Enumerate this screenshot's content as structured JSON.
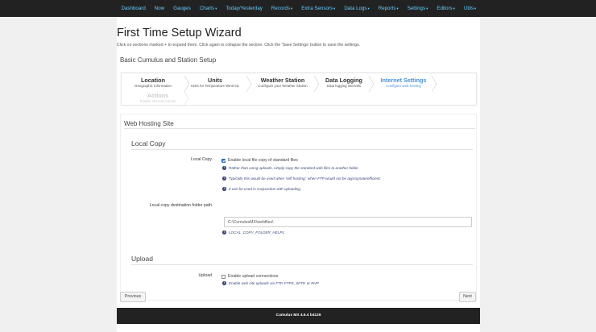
{
  "nav": {
    "items": [
      {
        "label": "Dashboard",
        "dropdown": false
      },
      {
        "label": "Now",
        "dropdown": false
      },
      {
        "label": "Gauges",
        "dropdown": false
      },
      {
        "label": "Charts",
        "dropdown": true
      },
      {
        "label": "Today/Yesterday",
        "dropdown": false
      },
      {
        "label": "Records",
        "dropdown": true
      },
      {
        "label": "Extra Sensors",
        "dropdown": true
      },
      {
        "label": "Data Logs",
        "dropdown": true
      },
      {
        "label": "Reports",
        "dropdown": true
      },
      {
        "label": "Settings",
        "dropdown": true
      },
      {
        "label": "Editors",
        "dropdown": true
      },
      {
        "label": "Utils",
        "dropdown": true
      }
    ]
  },
  "page": {
    "title": "First Time Setup Wizard",
    "intro": "Click on sections marked + to expand them. Click again to collapse the section. Click the 'Save Settings' button to save the settings.",
    "section_title": "Basic Cumulus and Station Setup"
  },
  "wizard": {
    "steps": [
      {
        "name": "Location",
        "sub": "Geographic Information",
        "state": "done"
      },
      {
        "name": "Units",
        "sub": "Units for Temperature Wind etc",
        "state": "done"
      },
      {
        "name": "Weather Station",
        "sub": "Configure your Weather Station",
        "state": "done"
      },
      {
        "name": "Data Logging",
        "sub": "Data logging intervals",
        "state": "done"
      },
      {
        "name": "Internet Settings",
        "sub": "Configure web hosting",
        "state": "current"
      },
      {
        "name": "Actions",
        "sub": "Enable Interval Actions",
        "state": "disabled"
      }
    ]
  },
  "panel": {
    "heading": "Web Hosting Site",
    "local_copy": {
      "legend": "Local Copy",
      "field_label": "Local Copy",
      "checkbox_label": "Enable local file copy of standard files",
      "checked": true,
      "help": [
        "Rather than using uploads, simply copy the standard web files to another folder.",
        "Typically this would be used when 'self hosting', when FTP would not be appropriate/efficient.",
        "It can be used in conjunction with uploading."
      ],
      "path_label": "Local copy destination folder path",
      "path_value": "C:\\CumulusMX\\webfiles\\",
      "path_help": "LOCAL_COPY_FOLDER_HELP1"
    },
    "upload": {
      "legend": "Upload",
      "field_label": "Upload",
      "checkbox_label": "Enable upload connections",
      "checked": false,
      "help": "Enable web site uploads via FTP, FTPS, SFTP, or PHP"
    }
  },
  "buttons": {
    "previous": "Previous",
    "next": "Next"
  },
  "footer": {
    "text": "Cumulus MX 4.6.4 b4126"
  }
}
